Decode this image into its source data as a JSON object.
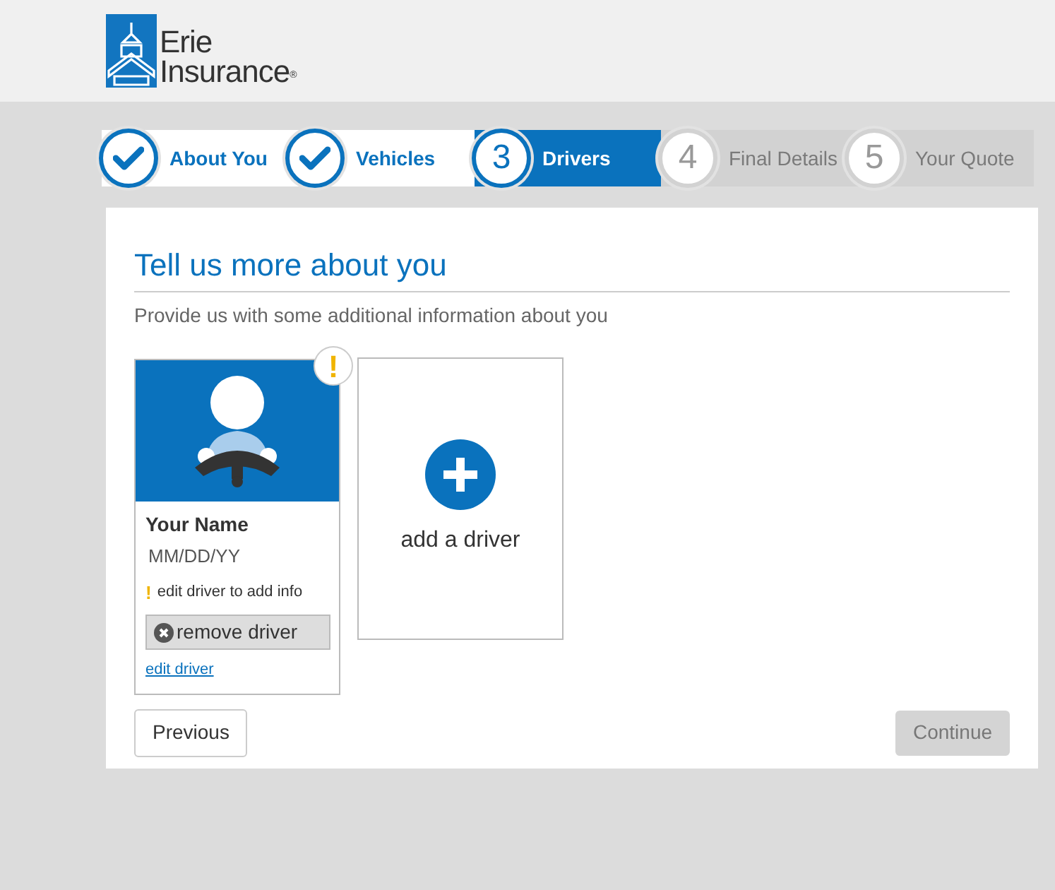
{
  "logo": {
    "line1": "Erie",
    "line2": "Insurance",
    "mark": "®"
  },
  "steps": [
    {
      "label": "About You",
      "done": true,
      "selected": false
    },
    {
      "label": "Vehicles",
      "done": true,
      "selected": false
    },
    {
      "label": "Drivers",
      "number": "3",
      "done": false,
      "selected": true
    },
    {
      "label": "Final Details",
      "number": "4",
      "done": false,
      "selected": false
    },
    {
      "label": "Your Quote",
      "number": "5",
      "done": false,
      "selected": false
    }
  ],
  "heading": "Tell us more about you",
  "subheading": "Provide us with some additional information about you",
  "drivers": [
    {
      "name": "Your Name",
      "dob": "MM/DD/YY",
      "alert_mark": "!",
      "warning": "edit driver to add info",
      "warning_mark": "!",
      "remove": "remove driver",
      "edit": "edit driver",
      "incomplete": true
    }
  ],
  "add_driver": "add a driver",
  "buttons": {
    "previous": "Previous",
    "continue": "Continue",
    "continue_disabled": true
  }
}
